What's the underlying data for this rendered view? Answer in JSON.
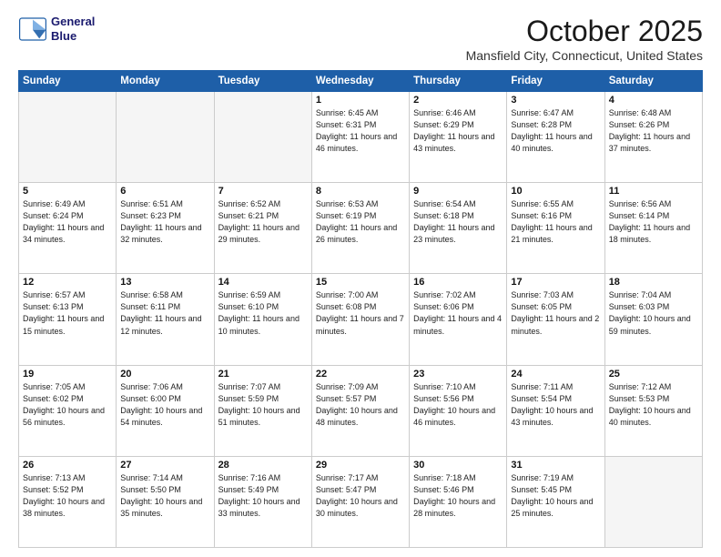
{
  "logo": {
    "line1": "General",
    "line2": "Blue"
  },
  "title": "October 2025",
  "subtitle": "Mansfield City, Connecticut, United States",
  "days_of_week": [
    "Sunday",
    "Monday",
    "Tuesday",
    "Wednesday",
    "Thursday",
    "Friday",
    "Saturday"
  ],
  "weeks": [
    [
      {
        "day": "",
        "info": ""
      },
      {
        "day": "",
        "info": ""
      },
      {
        "day": "",
        "info": ""
      },
      {
        "day": "1",
        "info": "Sunrise: 6:45 AM\nSunset: 6:31 PM\nDaylight: 11 hours and 46 minutes."
      },
      {
        "day": "2",
        "info": "Sunrise: 6:46 AM\nSunset: 6:29 PM\nDaylight: 11 hours and 43 minutes."
      },
      {
        "day": "3",
        "info": "Sunrise: 6:47 AM\nSunset: 6:28 PM\nDaylight: 11 hours and 40 minutes."
      },
      {
        "day": "4",
        "info": "Sunrise: 6:48 AM\nSunset: 6:26 PM\nDaylight: 11 hours and 37 minutes."
      }
    ],
    [
      {
        "day": "5",
        "info": "Sunrise: 6:49 AM\nSunset: 6:24 PM\nDaylight: 11 hours and 34 minutes."
      },
      {
        "day": "6",
        "info": "Sunrise: 6:51 AM\nSunset: 6:23 PM\nDaylight: 11 hours and 32 minutes."
      },
      {
        "day": "7",
        "info": "Sunrise: 6:52 AM\nSunset: 6:21 PM\nDaylight: 11 hours and 29 minutes."
      },
      {
        "day": "8",
        "info": "Sunrise: 6:53 AM\nSunset: 6:19 PM\nDaylight: 11 hours and 26 minutes."
      },
      {
        "day": "9",
        "info": "Sunrise: 6:54 AM\nSunset: 6:18 PM\nDaylight: 11 hours and 23 minutes."
      },
      {
        "day": "10",
        "info": "Sunrise: 6:55 AM\nSunset: 6:16 PM\nDaylight: 11 hours and 21 minutes."
      },
      {
        "day": "11",
        "info": "Sunrise: 6:56 AM\nSunset: 6:14 PM\nDaylight: 11 hours and 18 minutes."
      }
    ],
    [
      {
        "day": "12",
        "info": "Sunrise: 6:57 AM\nSunset: 6:13 PM\nDaylight: 11 hours and 15 minutes."
      },
      {
        "day": "13",
        "info": "Sunrise: 6:58 AM\nSunset: 6:11 PM\nDaylight: 11 hours and 12 minutes."
      },
      {
        "day": "14",
        "info": "Sunrise: 6:59 AM\nSunset: 6:10 PM\nDaylight: 11 hours and 10 minutes."
      },
      {
        "day": "15",
        "info": "Sunrise: 7:00 AM\nSunset: 6:08 PM\nDaylight: 11 hours and 7 minutes."
      },
      {
        "day": "16",
        "info": "Sunrise: 7:02 AM\nSunset: 6:06 PM\nDaylight: 11 hours and 4 minutes."
      },
      {
        "day": "17",
        "info": "Sunrise: 7:03 AM\nSunset: 6:05 PM\nDaylight: 11 hours and 2 minutes."
      },
      {
        "day": "18",
        "info": "Sunrise: 7:04 AM\nSunset: 6:03 PM\nDaylight: 10 hours and 59 minutes."
      }
    ],
    [
      {
        "day": "19",
        "info": "Sunrise: 7:05 AM\nSunset: 6:02 PM\nDaylight: 10 hours and 56 minutes."
      },
      {
        "day": "20",
        "info": "Sunrise: 7:06 AM\nSunset: 6:00 PM\nDaylight: 10 hours and 54 minutes."
      },
      {
        "day": "21",
        "info": "Sunrise: 7:07 AM\nSunset: 5:59 PM\nDaylight: 10 hours and 51 minutes."
      },
      {
        "day": "22",
        "info": "Sunrise: 7:09 AM\nSunset: 5:57 PM\nDaylight: 10 hours and 48 minutes."
      },
      {
        "day": "23",
        "info": "Sunrise: 7:10 AM\nSunset: 5:56 PM\nDaylight: 10 hours and 46 minutes."
      },
      {
        "day": "24",
        "info": "Sunrise: 7:11 AM\nSunset: 5:54 PM\nDaylight: 10 hours and 43 minutes."
      },
      {
        "day": "25",
        "info": "Sunrise: 7:12 AM\nSunset: 5:53 PM\nDaylight: 10 hours and 40 minutes."
      }
    ],
    [
      {
        "day": "26",
        "info": "Sunrise: 7:13 AM\nSunset: 5:52 PM\nDaylight: 10 hours and 38 minutes."
      },
      {
        "day": "27",
        "info": "Sunrise: 7:14 AM\nSunset: 5:50 PM\nDaylight: 10 hours and 35 minutes."
      },
      {
        "day": "28",
        "info": "Sunrise: 7:16 AM\nSunset: 5:49 PM\nDaylight: 10 hours and 33 minutes."
      },
      {
        "day": "29",
        "info": "Sunrise: 7:17 AM\nSunset: 5:47 PM\nDaylight: 10 hours and 30 minutes."
      },
      {
        "day": "30",
        "info": "Sunrise: 7:18 AM\nSunset: 5:46 PM\nDaylight: 10 hours and 28 minutes."
      },
      {
        "day": "31",
        "info": "Sunrise: 7:19 AM\nSunset: 5:45 PM\nDaylight: 10 hours and 25 minutes."
      },
      {
        "day": "",
        "info": ""
      }
    ]
  ]
}
